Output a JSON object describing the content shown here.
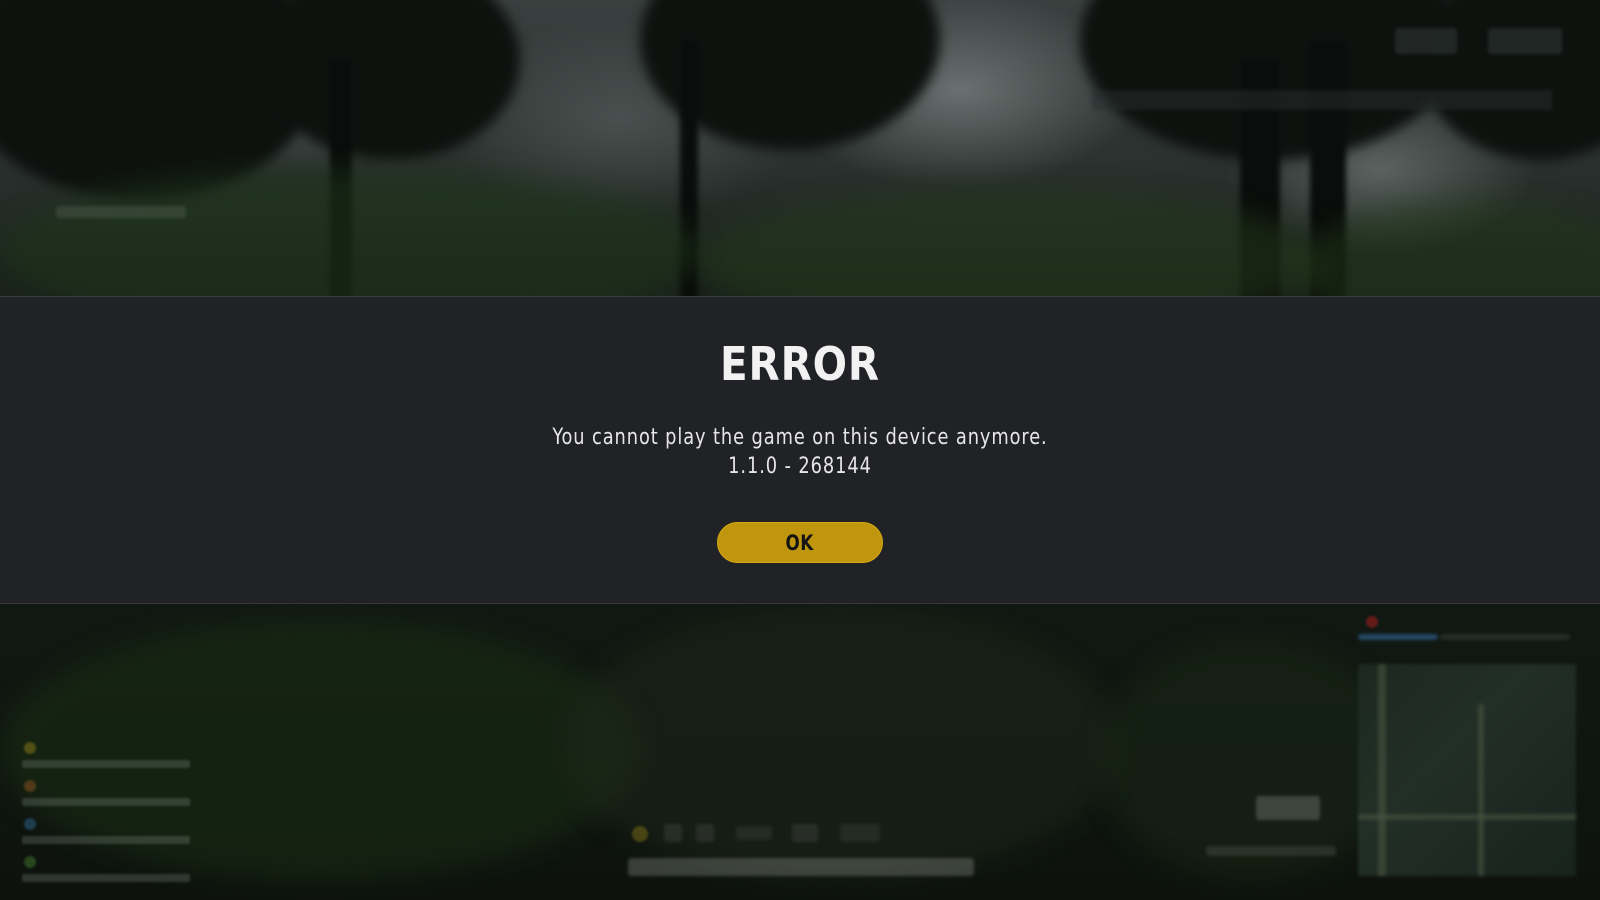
{
  "dialog": {
    "title": "ERROR",
    "message": "You cannot play the game on this device anymore.",
    "version": "1.1.0 - 268144",
    "ok_label": "OK"
  },
  "colors": {
    "dialog_background": "#202226",
    "ok_button": "#c0960f",
    "title_text": "#f2f2f2"
  }
}
